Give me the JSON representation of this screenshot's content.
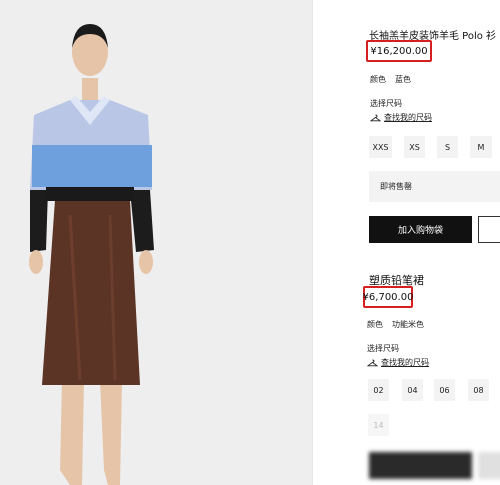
{
  "product1": {
    "title": "长袖羔羊皮装饰羊毛 Polo 衫",
    "price": "¥16,200.00",
    "color_label": "颜色",
    "color_value": "蓝色",
    "size_label": "选择尺码",
    "size_guide": "查找我的尺码",
    "sizes": [
      "XXS",
      "XS",
      "S",
      "M"
    ],
    "notify": "即将售罄",
    "add_to_cart": "加入购物袋"
  },
  "product2": {
    "title": "塑质铅笔裙",
    "price": "¥6,700.00",
    "color_label": "颜色",
    "color_value": "功能米色",
    "size_label": "选择尺码",
    "size_guide": "查找我的尺码",
    "sizes": [
      "02",
      "04",
      "06",
      "08",
      "14"
    ]
  },
  "colors": {
    "highlight": "#d62020",
    "button_dark": "#111111",
    "chip_bg": "#f3f3f3"
  }
}
